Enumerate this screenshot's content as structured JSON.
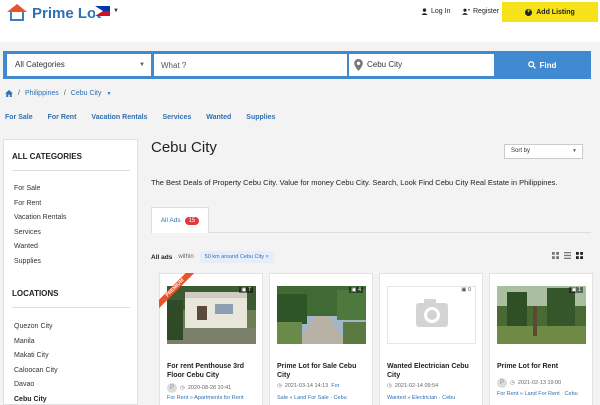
{
  "header": {
    "brand": "Prime Lot",
    "login": "Log In",
    "register": "Register",
    "add_listing": "Add Listing"
  },
  "search": {
    "category": "All Categories",
    "what_placeholder": "What ?",
    "location": "Cebu City",
    "find": "Find"
  },
  "breadcrumb": [
    "Philippines",
    "Cebu City"
  ],
  "catnav": [
    "For Sale",
    "For Rent",
    "Vacation Rentals",
    "Services",
    "Wanted",
    "Supplies"
  ],
  "sidebar": {
    "categories_title": "ALL CATEGORIES",
    "categories": [
      "For Sale",
      "For Rent",
      "Vacation Rentals",
      "Services",
      "Wanted",
      "Supplies"
    ],
    "locations_title": "LOCATIONS",
    "locations": [
      "Quezon City",
      "Manila",
      "Makati City",
      "Caloocan City",
      "Davao",
      "Cebu City"
    ]
  },
  "main": {
    "title": "Cebu City",
    "sort_by": "Sort by",
    "description": "The Best Deals of Property Cebu City. Value for money Cebu City. Search, Look Find Cebu City Real Estate in Philippines.",
    "tab_label": "All Ads",
    "tab_count": "15",
    "ads_label": "All ads",
    "within": "within",
    "chip": "50 km around Cebu City"
  },
  "cards": [
    {
      "title": "For rent Penthouse 3rd Floor Cebu City",
      "date": "2020-08-28 10:41",
      "cats": "For Rent » Apartments for Rent",
      "photos": "7",
      "premium": "PREMIUM",
      "avatar": "P"
    },
    {
      "title": "Prime Lot for Sale Cebu City",
      "date": "2021-03-14 14:13",
      "cats": "Sale » Land For Sale · Cebu",
      "photos": "4",
      "premium": "",
      "avatar": "P",
      "cats_pre": "For"
    },
    {
      "title": "Wanted Electrician Cebu City",
      "date": "2021-02-14 09:54",
      "cats": "Wanted » Electrician · Cebu",
      "photos": "0",
      "premium": "",
      "avatar": ""
    },
    {
      "title": "Prime Lot for Rent",
      "date": "2021-02-13 19:00",
      "cats": "For Rent » Land For Rent · Cebu",
      "photos": "1",
      "premium": "",
      "avatar": "P"
    }
  ],
  "colors": {
    "brand_blue": "#3f8ad0",
    "accent_yellow": "#f5e21b",
    "premium_orange": "#e8542a",
    "badge_red": "#e03a3e"
  }
}
